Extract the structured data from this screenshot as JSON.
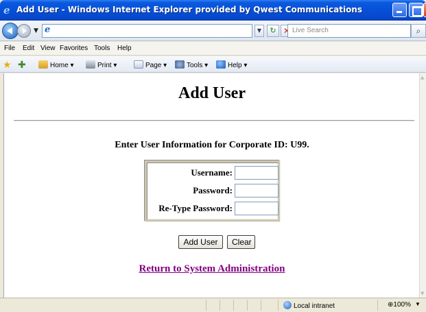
{
  "window": {
    "title": "Add User - Windows Internet Explorer provided by Qwest Communications"
  },
  "address_bar": {
    "url": "",
    "search_placeholder": "Live Search"
  },
  "menu": [
    "File",
    "Edit",
    "View",
    "Favorites",
    "Tools",
    "Help"
  ],
  "toolbar": {
    "home": "Home",
    "print": "Print",
    "page": "Page",
    "tools": "Tools",
    "help": "Help"
  },
  "page": {
    "title": "Add User",
    "subtitle": "Enter User Information for Corporate ID: U99.",
    "fields": [
      {
        "label": "Username:",
        "value": ""
      },
      {
        "label": "Password:",
        "value": ""
      },
      {
        "label": "Re-Type Password:",
        "value": ""
      }
    ],
    "buttons": {
      "add": "Add User",
      "clear": "Clear"
    },
    "return_link": "Return to System Administration"
  },
  "status_bar": {
    "zone": "Local intranet",
    "zoom": "100%"
  },
  "colors": {
    "titlebar": "#0650d8",
    "visited_link": "#800080"
  }
}
